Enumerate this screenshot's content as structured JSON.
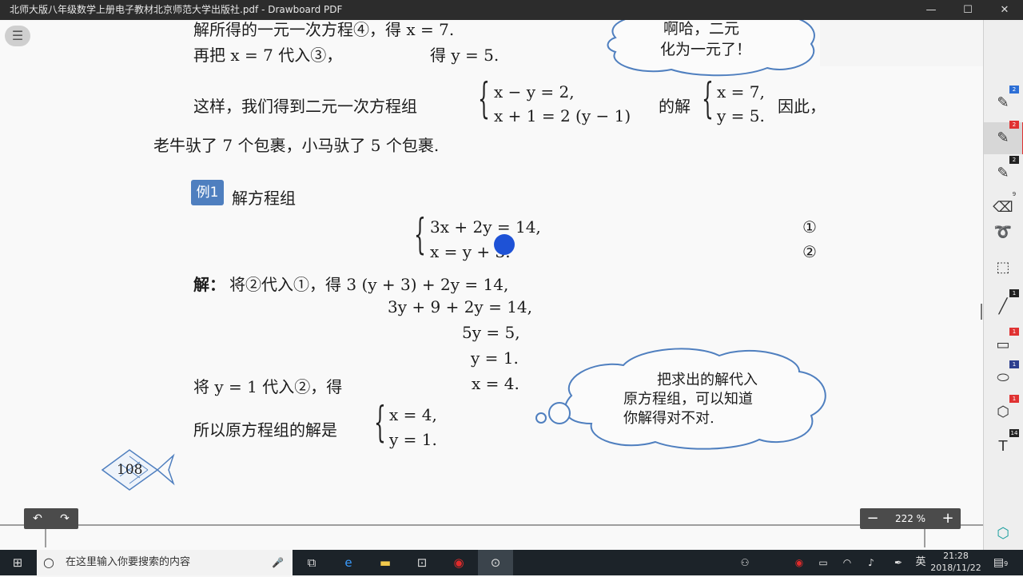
{
  "window": {
    "title": "北师大版八年级数学上册电子教材北京师范大学出版社.pdf - Drawboard PDF",
    "minimize_icon": "—",
    "maximize_icon": "☐",
    "close_icon": "✕"
  },
  "menu_icon": "☰",
  "document": {
    "line1": "解所得的一元一次方程④，得 x = 7.",
    "line2a": "再把 x = 7 代入③，",
    "line2b": "得 y = 5.",
    "bubble1_line1": "啊哈，二元",
    "bubble1_line2": "化为一元了！",
    "line3a": "这样，我们得到二元一次方程组",
    "sys1_eq1": "x − y = 2,",
    "sys1_eq2": "x + 1 = 2 (y − 1)",
    "line3b": "的解",
    "sol1_x": "x = 7,",
    "sol1_y": "y = 5.",
    "line3c": "因此，",
    "line4": "老牛驮了 7 个包裹，小马驮了 5 个包裹.",
    "example_tag": "例1",
    "example_title": "解方程组",
    "ex_eq1": "3x + 2y = 14,",
    "ex_eq2": "x = y + 3.",
    "ex_mark1": "①",
    "ex_mark2": "②",
    "sol_label": "解：",
    "step1": "将②代入①，得 3 (y + 3) + 2y = 14,",
    "step2": "3y + 9 + 2y = 14,",
    "step3": "5y = 5,",
    "step4": "y = 1.",
    "step5a": "将 y = 1 代入②，得",
    "step5b": "x = 4.",
    "conclusion": "所以原方程组的解是",
    "final_x": "x = 4,",
    "final_y": "y = 1.",
    "bubble2_line1": "把求出的解代入",
    "bubble2_line2": "原方程组，可以知道",
    "bubble2_line3": "你解得对不对.",
    "page_number": "108"
  },
  "undo_icon": "↶",
  "redo_icon": "↷",
  "zoom": {
    "minus": "−",
    "value": "222 %",
    "plus": "+"
  },
  "toolbar": {
    "tools": [
      {
        "icon": "pen-icon",
        "glyph": "✎",
        "badge": "2",
        "badge_color": "#2d6fd6"
      },
      {
        "icon": "pen-icon",
        "glyph": "✎",
        "badge": "2",
        "badge_color": "#e03232"
      },
      {
        "icon": "highlighter-icon",
        "glyph": "✎",
        "badge": "2",
        "badge_color": "#222222"
      },
      {
        "icon": "eraser-icon",
        "glyph": "⌫",
        "badge": "9",
        "badge_color": ""
      },
      {
        "icon": "lasso-icon",
        "glyph": "➰",
        "badge": "",
        "badge_color": ""
      },
      {
        "icon": "select-icon",
        "glyph": "⬚",
        "badge": "",
        "badge_color": ""
      },
      {
        "icon": "line-icon",
        "glyph": "╱",
        "badge": "1",
        "badge_color": "#222222"
      },
      {
        "icon": "rectangle-icon",
        "glyph": "▭",
        "badge": "1",
        "badge_color": "#e03232"
      },
      {
        "icon": "ellipse-icon",
        "glyph": "⬭",
        "badge": "1",
        "badge_color": "#2d3f8f"
      },
      {
        "icon": "polygon-icon",
        "glyph": "⬡",
        "badge": "1",
        "badge_color": "#e03232"
      },
      {
        "icon": "text-icon",
        "glyph": "T",
        "badge": "14",
        "badge_color": "#222222"
      }
    ],
    "bottom_icon": "⬡"
  },
  "taskbar": {
    "start_icon": "⊞",
    "search_icon": "○",
    "search_placeholder": "在这里输入你要搜索的内容",
    "mic_icon": "🎤",
    "apps": [
      "task-view-icon",
      "edge-icon",
      "file-explorer-icon",
      "store-icon",
      "record-icon",
      "drawboard-icon"
    ],
    "ime": "英",
    "time": "21:28",
    "date": "2018/11/22",
    "notification_count": "9"
  }
}
